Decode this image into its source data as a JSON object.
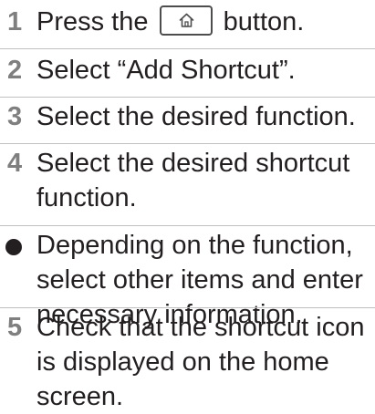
{
  "steps": [
    {
      "num": "1",
      "before": "Press the",
      "after": "button."
    },
    {
      "num": "2",
      "line1": "Select “Add Shortcut”."
    },
    {
      "num": "3",
      "line1": "Select the desired function."
    },
    {
      "num": "4",
      "line1": "Select the desired shortcut",
      "line2": "function."
    },
    {
      "num": "5",
      "line1": "Check that the shortcut icon",
      "line2": "is displayed on the home",
      "line3": "screen."
    }
  ],
  "note": {
    "line1": "Depending on the function,",
    "line2": "select other items and enter",
    "line3": "necessary information."
  },
  "icons": {
    "home_button": "home-icon"
  },
  "colors": {
    "step_number": "#7f7f7f",
    "text": "#231f20",
    "divider": "#bfbfbf"
  }
}
